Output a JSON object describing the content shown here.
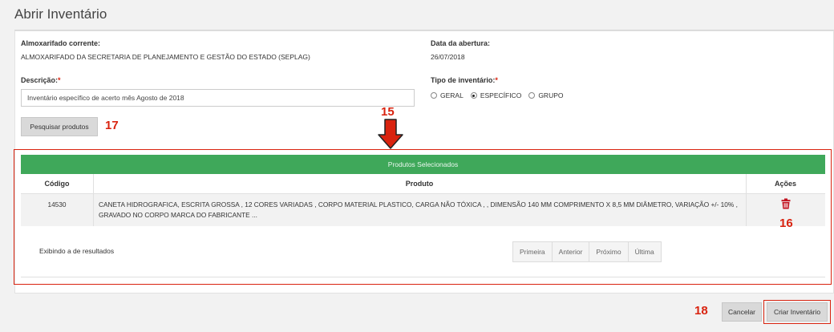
{
  "page": {
    "title": "Abrir Inventário"
  },
  "form": {
    "almoxarifado_label": "Almoxarifado corrente:",
    "almoxarifado_value": "ALMOXARIFADO DA SECRETARIA DE PLANEJAMENTO E GESTÃO DO ESTADO (SEPLAG)",
    "data_label": "Data da abertura:",
    "data_value": "26/07/2018",
    "descricao_label": "Descrição:",
    "descricao_value": "Inventário específico de acerto mês Agosto de 2018",
    "required_mark": "*",
    "tipo_label": "Tipo de inventário:",
    "tipo_options": [
      "GERAL",
      "ESPECÍFICO",
      "GRUPO"
    ],
    "tipo_selected": "ESPECÍFICO",
    "search_button": "Pesquisar produtos"
  },
  "callouts": {
    "c15": "15",
    "c16": "16",
    "c17": "17",
    "c18": "18"
  },
  "colors": {
    "accent_green": "#3fa85a",
    "callout_red": "#d9230f"
  },
  "table": {
    "title": "Produtos Selecionados",
    "headers": {
      "codigo": "Código",
      "produto": "Produto",
      "acoes": "Ações"
    },
    "rows": [
      {
        "codigo": "14530",
        "produto_line1": "CANETA HIDROGRAFICA, ESCRITA GROSSA , 12 CORES VARIADAS , CORPO MATERIAL PLASTICO, CARGA NÃO TÓXICA , , DIMENSÃO 140 MM COMPRIMENTO X 8,5 MM DIÂMETRO, VARIAÇÃO +/- 10% ,",
        "produto_line2": "GRAVADO NO CORPO MARCA DO FABRICANTE ...",
        "action_icon": "trash-icon"
      }
    ],
    "results_text": "Exibindo a de resultados",
    "pager": [
      "Primeira",
      "Anterior",
      "Próximo",
      "Última"
    ]
  },
  "footer": {
    "cancel": "Cancelar",
    "create": "Criar Inventário"
  }
}
